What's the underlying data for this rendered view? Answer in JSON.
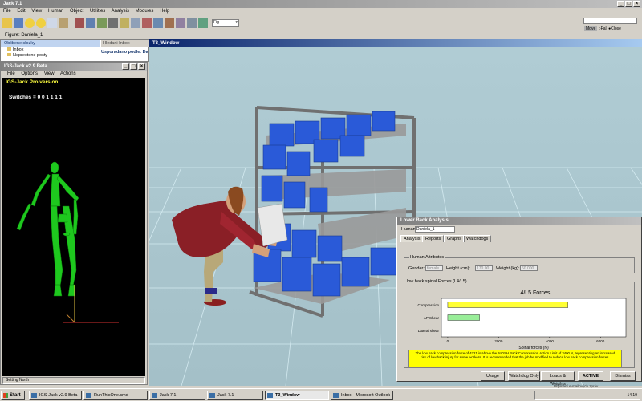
{
  "jack": {
    "title": "Jack 7.1",
    "menu": [
      "File",
      "Edit",
      "View",
      "Human",
      "Object",
      "Utilities",
      "Analysis",
      "Modules",
      "Help"
    ],
    "figure_label": "Figure: Daniela_1",
    "dropdown_value": "Fig",
    "radio_labels": [
      "Move",
      "Fall",
      "Close"
    ]
  },
  "outlook": {
    "header_left": "Oblibene slozky",
    "items": [
      "Inbox",
      "Neprectene posty",
      "Sent Items"
    ],
    "header_right": "Hledani Inbox",
    "arrange_label": "Usporadano podle: Da"
  },
  "igs": {
    "title": "IGS-Jack v2.9 Beta",
    "menu": [
      "File",
      "Options",
      "View",
      "Actions"
    ],
    "version_label": "IGS-Jack Pro version",
    "switches_label": "Switches = 0 0 1 1 1 1",
    "status": "Setting North"
  },
  "viewport": {
    "title": "T3_Window"
  },
  "analysis": {
    "title": "Lower Back Analysis",
    "human_label": "Human",
    "human_value": "Daniela_1",
    "tabs": [
      "Analysis",
      "Reports",
      "Graphs",
      "Watchdogs"
    ],
    "human_attributes_title": "Human Attributes",
    "gender_label": "Gender:",
    "gender_value": "female",
    "height_label": "Height (cm):",
    "height_value": "170.00",
    "weight_label": "Weight (kg):",
    "weight_value": "60.000",
    "spinal_title": "low back spinal Forces (L4/L5)",
    "warning": "The low back compression force of 4721 is above the NIOSH Back Compression Action Limit of 3400 N, representing an increased risk of low back injury for some workers. It is recommended that the job be modified to reduce low back compression forces.",
    "buttons": [
      "Usage",
      "Watchdog Only",
      "Loads & Weights",
      "ACTIVE",
      "Dismiss"
    ]
  },
  "chart_data": {
    "type": "bar",
    "title": "L4/L5 Forces",
    "xlabel": "Spinal forces (N)",
    "categories": [
      "Compression",
      "AP Shear",
      "Lateral shear"
    ],
    "values": [
      4721,
      1250,
      0
    ],
    "xlim": [
      -250,
      7000
    ],
    "xticks": [
      "0",
      "2000",
      "4000",
      "6000"
    ],
    "colors": {
      "compression": "#ffff33",
      "ap_shear": "#99ee99"
    }
  },
  "taskbar": {
    "start": "Start",
    "tasks": [
      "IGS-Jack v2.9 Beta",
      "RunThisOne.cmd",
      "Jack 7.1",
      "Jack 7.1",
      "T3_Window",
      "Inbox - Microsoft Outlook"
    ],
    "clock": "14:19",
    "tray_text": "Přijímání e-mailových zpráv"
  }
}
